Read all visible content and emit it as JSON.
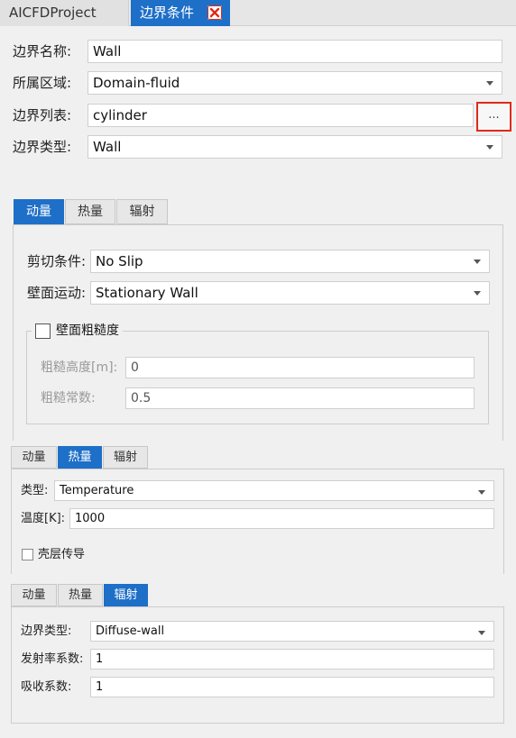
{
  "doc_tabs": {
    "project": "AICFDProject",
    "active": "边界条件"
  },
  "boundary": {
    "name_label": "边界名称:",
    "name_value": "Wall",
    "region_label": "所属区域:",
    "region_value": "Domain-fluid",
    "list_label": "边界列表:",
    "list_value": "cylinder",
    "browse_label": "...",
    "type_label": "边界类型:",
    "type_value": "Wall"
  },
  "tabs": [
    "动量",
    "热量",
    "辐射"
  ],
  "momentum": {
    "shear_label": "剪切条件:",
    "shear_value": "No Slip",
    "motion_label": "壁面运动:",
    "motion_value": "Stationary Wall",
    "roughness_group": "壁面粗糙度",
    "height_label": "粗糙高度[m]:",
    "height_value": "0",
    "constant_label": "粗糙常数:",
    "constant_value": "0.5"
  },
  "thermal": {
    "type_label": "类型:",
    "type_value": "Temperature",
    "temp_label": "温度[K]:",
    "temp_value": "1000",
    "shell_label": "壳层传导"
  },
  "radiation": {
    "type_label": "边界类型:",
    "type_value": "Diffuse-wall",
    "emissivity_label": "发射率系数:",
    "emissivity_value": "1",
    "absorption_label": "吸收系数:",
    "absorption_value": "1"
  },
  "colors": {
    "accent": "#1e6fc8",
    "highlight": "#e02a1a"
  },
  "icons": {
    "close": "close-icon",
    "dropdown": "chevron-down-icon",
    "checkbox": "checkbox-icon"
  }
}
